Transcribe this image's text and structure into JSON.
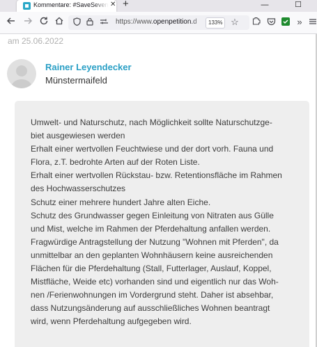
{
  "browser": {
    "tab": {
      "title": "Kommentare: #SaveSevenich -"
    },
    "url": {
      "prefix": "https://www.",
      "domain": "openpetition.d"
    },
    "zoom": "133%",
    "icons": {
      "back": "back-arrow-icon",
      "forward": "forward-arrow-icon",
      "reload": "reload-icon",
      "home": "home-icon",
      "shield": "shield-icon",
      "lock": "lock-icon",
      "permissions": "permissions-icon",
      "bookmark": "bookmark-star-icon",
      "extensions": "extensions-icon",
      "pocket": "pocket-icon",
      "checkbox_ext": "green-check-extension-icon",
      "overflow": "overflow-chevron-icon",
      "menu": "hamburger-menu-icon"
    }
  },
  "page": {
    "date": "am 25.06.2022",
    "author": {
      "name": "Rainer Leyendecker",
      "location": "Münstermaifeld"
    },
    "comment_lines": [
      "Umwelt- und Naturschutz, nach Möglichkeit sollte Naturschutzge-",
      "biet ausgewiesen werden",
      "Erhalt einer wertvollen Feuchtwiese und der dort vorh. Fauna und",
      "Flora, z.T. bedrohte Arten auf der Roten Liste.",
      "Erhalt einer wertvollen Rückstau- bzw. Retentionsfläche im Rahmen",
      "des Hochwasserschutzes",
      "Schutz einer mehrere hundert Jahre alten Eiche.",
      "Schutz des Grundwasser gegen Einleitung von Nitraten aus Gülle",
      "und Mist, welche im Rahmen der Pferdehaltung anfallen werden.",
      "Fragwürdige Antragstellung der Nutzung \"Wohnen mit Pferden\", da",
      "unmittelbar an den geplanten Wohnhäusern keine ausreichenden",
      "Flächen für die Pferdehaltung (Stall, Futterlager, Auslauf, Koppel,",
      "Mistfläche, Weide etc) vorhanden sind und eigentlich nur das Woh-",
      "nen /Ferienwohnungen im Vordergrund steht. Daher ist absehbar,",
      "dass Nutzungsänderung auf ausschließliches Wohnen beantragt",
      "wird, wenn Pferdehaltung aufgegeben wird."
    ]
  }
}
